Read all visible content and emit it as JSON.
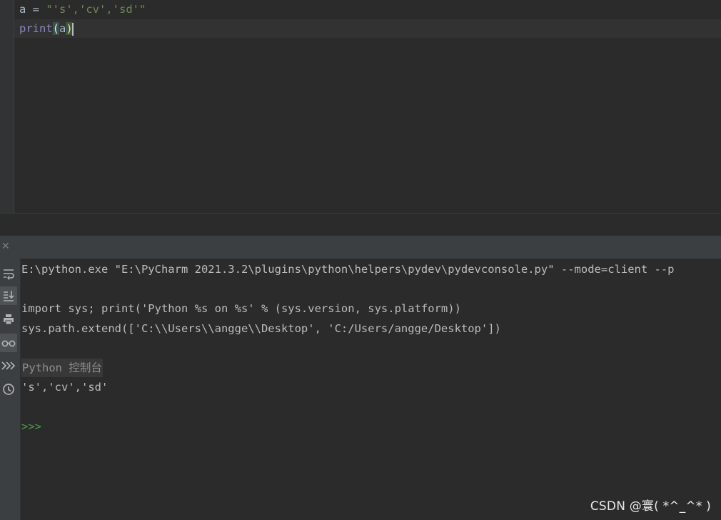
{
  "editor": {
    "line1": {
      "var": "a",
      "op": " = ",
      "str": "\"'s','cv','sd'\""
    },
    "line2": {
      "fn": "print",
      "open": "(",
      "arg": "a",
      "close": ")"
    }
  },
  "console": {
    "command": "E:\\python.exe \"E:\\PyCharm 2021.3.2\\plugins\\python\\helpers\\pydev\\pydevconsole.py\" --mode=client --p",
    "import_line1": "import sys; print('Python %s on %s' % (sys.version, sys.platform))",
    "import_line2": "sys.path.extend(['C:\\\\Users\\\\angge\\\\Desktop', 'C:/Users/angge/Desktop'])",
    "label": "Python 控制台",
    "output": "'s','cv','sd'",
    "prompt": ">>>"
  },
  "toolbar": {
    "close_glyph": "✕",
    "buttons": [
      "soft-wrap-icon",
      "scroll-to-end-icon",
      "print-icon",
      "glasses-icon",
      "execute-icon",
      "history-icon"
    ]
  },
  "watermark": "CSDN @寰( *^_^* )",
  "colors": {
    "background": "#2b2b2b",
    "string": "#6a8759",
    "builtin": "#8888c6",
    "prompt": "#43a047"
  }
}
